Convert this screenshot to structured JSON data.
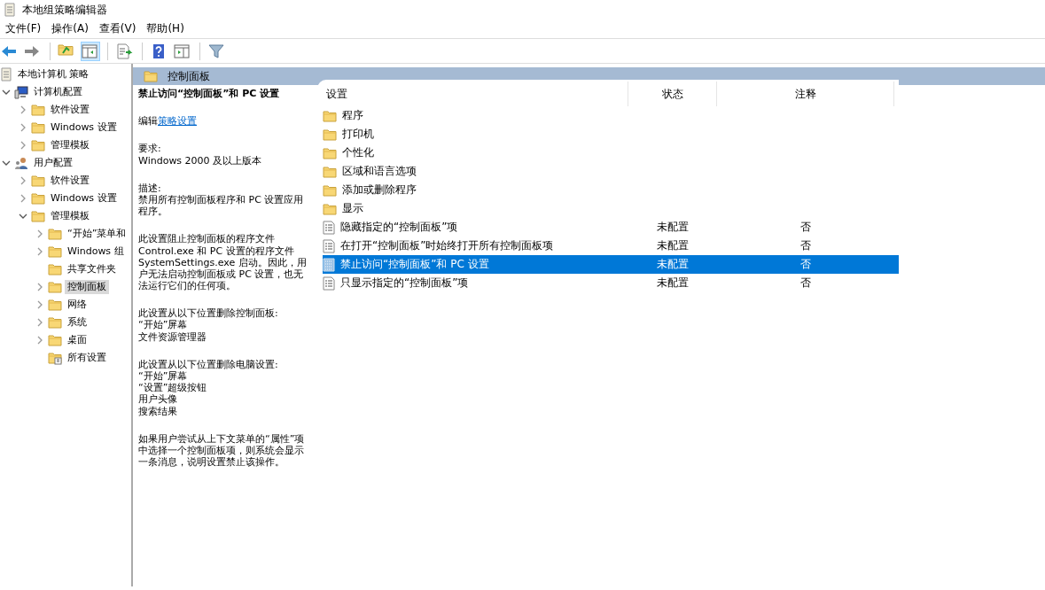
{
  "window": {
    "title": "本地组策略编辑器"
  },
  "menu": [
    "文件(F)",
    "操作(A)",
    "查看(V)",
    "帮助(H)"
  ],
  "toolbar": [
    {
      "kind": "back",
      "pressed": false
    },
    {
      "kind": "forward",
      "pressed": false
    },
    {
      "kind": "sep"
    },
    {
      "kind": "up",
      "pressed": false
    },
    {
      "kind": "tree",
      "pressed": true
    },
    {
      "kind": "sep"
    },
    {
      "kind": "export",
      "pressed": false
    },
    {
      "kind": "sep"
    },
    {
      "kind": "help",
      "pressed": false
    },
    {
      "kind": "pane",
      "pressed": false
    },
    {
      "kind": "sep"
    },
    {
      "kind": "filter",
      "pressed": false
    }
  ],
  "tree": {
    "label": "本地计算机 策略",
    "kind": "policy",
    "selected": false,
    "children": [
      {
        "label": "计算机配置",
        "kind": "computer",
        "expanded": true,
        "selected": false,
        "children": [
          {
            "label": "软件设置",
            "kind": "folder",
            "expanded": false,
            "selected": false
          },
          {
            "label": "Windows 设置",
            "kind": "folder",
            "expanded": false,
            "selected": false
          },
          {
            "label": "管理模板",
            "kind": "folder",
            "expanded": false,
            "selected": false
          }
        ]
      },
      {
        "label": "用户配置",
        "kind": "user",
        "expanded": true,
        "selected": false,
        "children": [
          {
            "label": "软件设置",
            "kind": "folder",
            "expanded": false,
            "selected": false
          },
          {
            "label": "Windows 设置",
            "kind": "folder",
            "expanded": false,
            "selected": false
          },
          {
            "label": "管理模板",
            "kind": "folder",
            "expanded": true,
            "selected": false,
            "children": [
              {
                "label": "“开始”菜单和",
                "kind": "folder",
                "expanded": false,
                "selected": false
              },
              {
                "label": "Windows 组",
                "kind": "folder",
                "expanded": false,
                "selected": false
              },
              {
                "label": "共享文件夹",
                "kind": "folder",
                "selected": false
              },
              {
                "label": "控制面板",
                "kind": "folder",
                "expanded": false,
                "selected": true
              },
              {
                "label": "网络",
                "kind": "folder",
                "expanded": false,
                "selected": false
              },
              {
                "label": "系统",
                "kind": "folder",
                "expanded": false,
                "selected": false
              },
              {
                "label": "桌面",
                "kind": "folder",
                "expanded": false,
                "selected": false
              },
              {
                "label": "所有设置",
                "kind": "allsettings",
                "selected": false
              }
            ]
          }
        ]
      }
    ]
  },
  "header": {
    "title": "控制面板"
  },
  "description": {
    "title": "禁止访问“控制面板”和 PC 设置",
    "edit_prefix": "编辑",
    "edit_link": "策略设置",
    "paragraphs": [
      [
        "要求:",
        "Windows 2000 及以上版本"
      ],
      [
        "描述:",
        "禁用所有控制面板程序和 PC 设置应用程序。"
      ],
      [
        "此设置阻止控制面板的程序文件 Control.exe 和 PC 设置的程序文件 SystemSettings.exe 启动。因此，用户无法启动控制面板或 PC 设置，也无法运行它们的任何项。"
      ],
      [
        "此设置从以下位置删除控制面板:",
        "“开始”屏幕",
        "文件资源管理器"
      ],
      [
        "此设置从以下位置删除电脑设置:",
        "“开始”屏幕",
        "“设置”超级按钮",
        "用户头像",
        "搜索结果"
      ],
      [
        "如果用户尝试从上下文菜单的“属性”项中选择一个控制面板项，则系统会显示一条消息，说明设置禁止该操作。"
      ]
    ]
  },
  "table": {
    "columns": [
      "设置",
      "状态",
      "注释"
    ],
    "rows": [
      {
        "kind": "folder",
        "name": "程序",
        "selected": false
      },
      {
        "kind": "folder",
        "name": "打印机",
        "selected": false
      },
      {
        "kind": "folder",
        "name": "个性化",
        "selected": false
      },
      {
        "kind": "folder",
        "name": "区域和语言选项",
        "selected": false
      },
      {
        "kind": "folder",
        "name": "添加或删除程序",
        "selected": false
      },
      {
        "kind": "folder",
        "name": "显示",
        "selected": false
      },
      {
        "kind": "setting",
        "name": "隐藏指定的“控制面板”项",
        "state": "未配置",
        "comment": "否",
        "selected": false
      },
      {
        "kind": "setting",
        "name": "在打开“控制面板”时始终打开所有控制面板项",
        "state": "未配置",
        "comment": "否",
        "selected": false
      },
      {
        "kind": "setting",
        "name": "禁止访问“控制面板”和 PC 设置",
        "state": "未配置",
        "comment": "否",
        "selected": true
      },
      {
        "kind": "setting",
        "name": "只显示指定的“控制面板”项",
        "state": "未配置",
        "comment": "否",
        "selected": false
      }
    ]
  }
}
